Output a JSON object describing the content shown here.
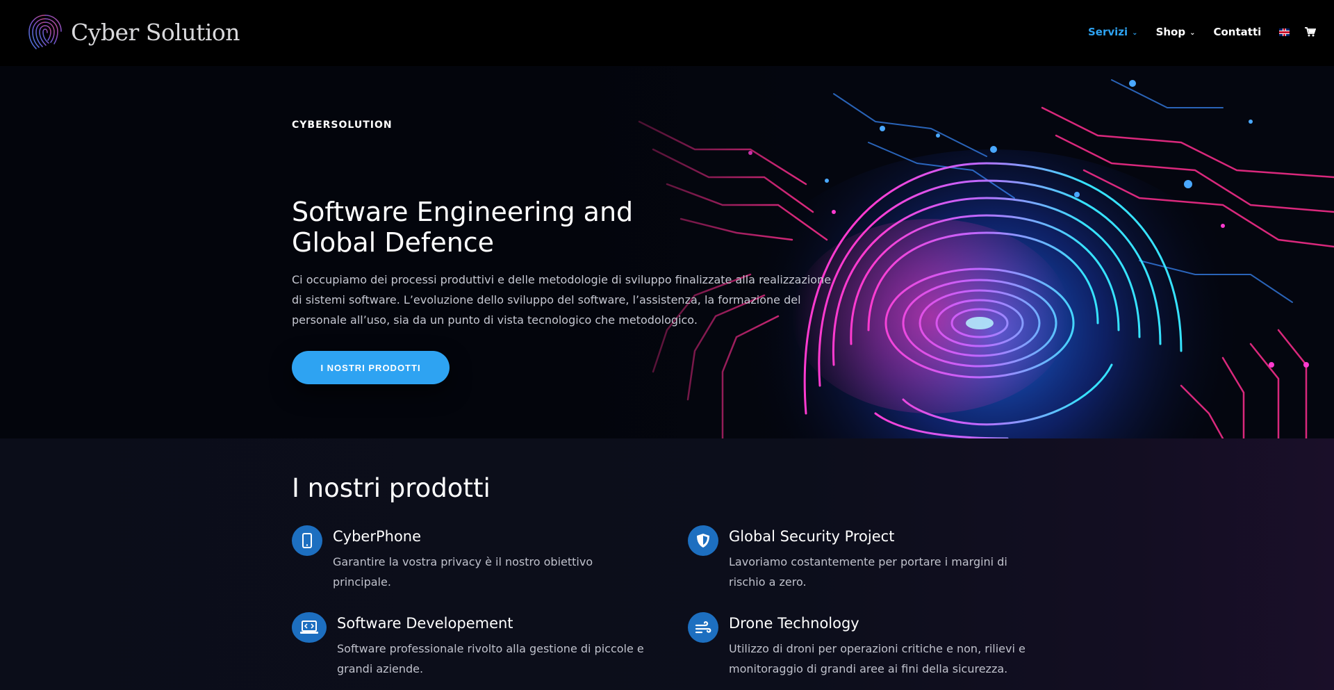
{
  "brand": {
    "name": "Cyber Solution",
    "logo_icon": "fingerprint-logo-icon"
  },
  "nav": {
    "items": [
      {
        "label": "Servizi",
        "has_dropdown": true,
        "active": true
      },
      {
        "label": "Shop",
        "has_dropdown": true,
        "active": false
      },
      {
        "label": "Contatti",
        "has_dropdown": false,
        "active": false
      }
    ],
    "language_icon": "uk-flag-icon",
    "cart_icon": "cart-icon"
  },
  "hero": {
    "eyebrow": "CYBERSOLUTION",
    "title": "Software Engineering and Global Defence",
    "text": "Ci occupiamo dei processi produttivi e delle metodologie di sviluppo finalizzate alla realizzazione di sistemi software. L’evoluzione dello sviluppo del software, l’assistenza, la formazione del personale all’uso, sia da un punto di vista tecnologico che metodologico.",
    "button_label": "I NOSTRI PRODOTTI",
    "background_icon": "fingerprint-circuit-image"
  },
  "products": {
    "title": "I nostri prodotti",
    "items": [
      {
        "icon": "smartphone-icon",
        "title": "CyberPhone",
        "text": "Garantire la vostra privacy è il nostro obiettivo principale."
      },
      {
        "icon": "shield-icon",
        "title": "Global Security Project",
        "text": "Lavoriamo costantemente per portare i margini di rischio a zero."
      },
      {
        "icon": "laptop-code-icon",
        "title": "Software Developement",
        "text": "Software professionale rivolto alla gestione di piccole e grandi aziende."
      },
      {
        "icon": "wind-icon",
        "title": "Drone Technology",
        "text": "Utilizzo di droni per operazioni critiche e non, rilievi e monitoraggio di grandi aree ai fini della sicurezza."
      }
    ]
  },
  "colors": {
    "accent": "#2ea3f2",
    "icon_bg": "#1d6fc0",
    "header_bg": "#000000",
    "section_bg": "#0b0d19"
  }
}
